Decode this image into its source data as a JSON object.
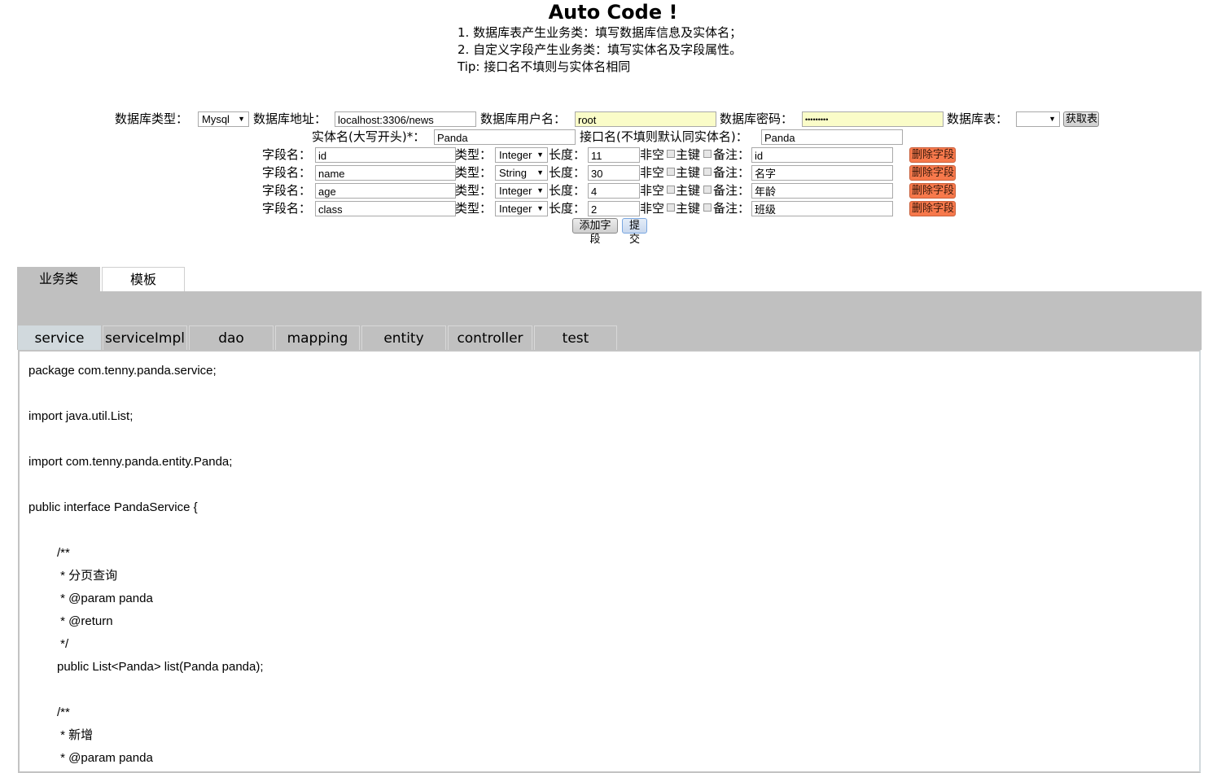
{
  "header": {
    "title": "Auto Code !",
    "instructions": [
      "1. 数据库表产生业务类：填写数据库信息及实体名；",
      "2. 自定义字段产生业务类：填写实体名及字段属性。",
      "Tip: 接口名不填则与实体名相同"
    ]
  },
  "db": {
    "type_label": "数据库类型：",
    "type_value": "Mysql",
    "address_label": "数据库地址：",
    "address_value": "localhost:3306/news",
    "user_label": "数据库用户名：",
    "user_value": "root",
    "password_label": "数据库密码：",
    "password_value": "•••••••••",
    "table_label": "数据库表：",
    "table_value": "",
    "fetch_button": "获取表"
  },
  "entity": {
    "name_label": "实体名(大写开头)*：",
    "name_value": "Panda",
    "interface_label": "接口名(不填则默认同实体名)：",
    "interface_value": "Panda"
  },
  "field_labels": {
    "name": "字段名：",
    "type": "类型：",
    "length": "长度：",
    "notnull": "非空",
    "primary": "主键",
    "remark": "备注：",
    "delete": "删除字段"
  },
  "fields": [
    {
      "name": "id",
      "type": "Integer",
      "length": "11",
      "remark": "id"
    },
    {
      "name": "name",
      "type": "String",
      "length": "30",
      "remark": "名字"
    },
    {
      "name": "age",
      "type": "Integer",
      "length": "4",
      "remark": "年龄"
    },
    {
      "name": "class",
      "type": "Integer",
      "length": "2",
      "remark": "班级"
    }
  ],
  "actions": {
    "add_field": "添加字段",
    "submit": "提交"
  },
  "top_tabs": [
    "业务类",
    "模板"
  ],
  "sub_tabs": [
    "service",
    "serviceImpl",
    "dao",
    "mapping",
    "entity",
    "controller",
    "test"
  ],
  "code_lines": [
    "package com.tenny.panda.service;",
    "",
    "import java.util.List;",
    "",
    "import com.tenny.panda.entity.Panda;",
    "",
    "public interface PandaService {",
    "",
    "/**",
    " * 分页查询",
    " * @param panda",
    " * @return",
    " */",
    "public List<Panda> list(Panda panda);",
    "",
    "/**",
    " * 新增",
    " * @param panda"
  ]
}
